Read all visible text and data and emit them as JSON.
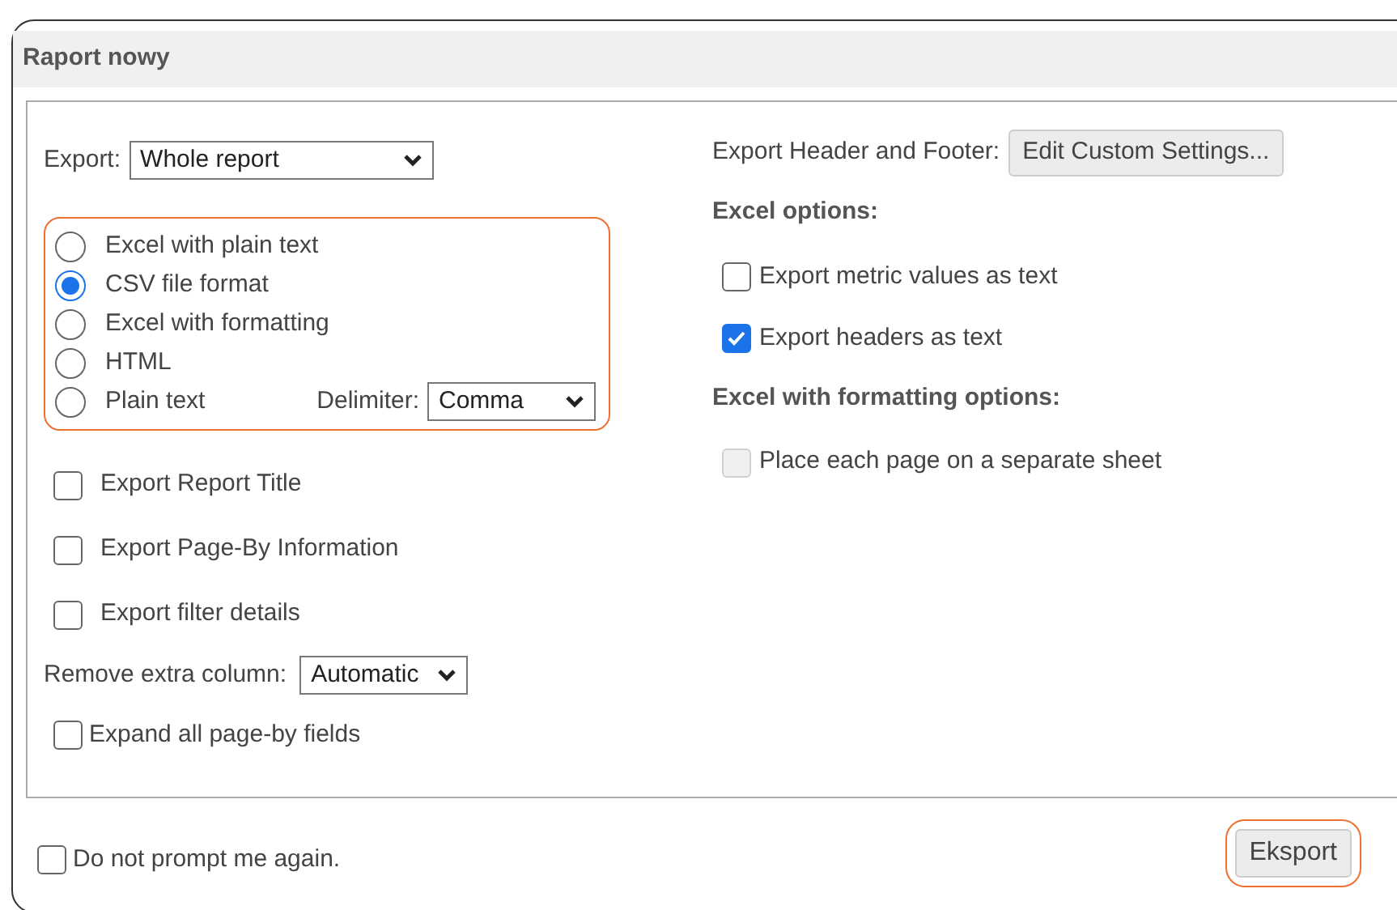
{
  "title": "Raport nowy",
  "export": {
    "label": "Export:",
    "value": "Whole report"
  },
  "formats": [
    {
      "label": "Excel with plain text",
      "selected": false
    },
    {
      "label": "CSV file format",
      "selected": true
    },
    {
      "label": "Excel with formatting",
      "selected": false
    },
    {
      "label": "HTML",
      "selected": false
    },
    {
      "label": "Plain text",
      "selected": false
    }
  ],
  "delimiter": {
    "label": "Delimiter:",
    "value": "Comma"
  },
  "left_options": [
    {
      "label": "Export Report Title",
      "checked": false
    },
    {
      "label": "Export Page-By Information",
      "checked": false
    },
    {
      "label": "Export filter details",
      "checked": false
    }
  ],
  "remove_extra_column": {
    "label": "Remove extra column:",
    "value": "Automatic"
  },
  "expand": {
    "label": "Expand all page-by fields",
    "checked": false
  },
  "header_footer": {
    "label": "Export Header and Footer:",
    "button": "Edit Custom Settings..."
  },
  "excel_options": {
    "heading": "Excel options:",
    "items": [
      {
        "label": "Export metric values as text",
        "checked": false,
        "disabled": false
      },
      {
        "label": "Export headers as text",
        "checked": true,
        "disabled": false
      }
    ]
  },
  "formatting_options": {
    "heading": "Excel with formatting options:",
    "items": [
      {
        "label": "Place each page on a separate sheet",
        "checked": false,
        "disabled": true
      }
    ]
  },
  "do_not_prompt": {
    "label": "Do not prompt me again.",
    "checked": false
  },
  "export_button": "Eksport"
}
